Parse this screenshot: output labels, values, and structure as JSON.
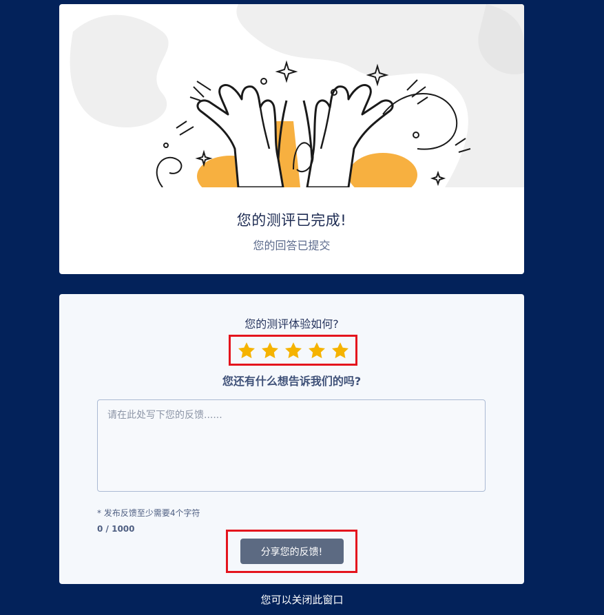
{
  "completion": {
    "title": "您的测评已完成!",
    "subtitle": "您的回答已提交"
  },
  "survey": {
    "rating_question": "您的测评体验如何?",
    "rating": {
      "value": 5,
      "max": 5,
      "star_color": "#f5b301"
    },
    "feedback_question": "您还有什么想告诉我们的吗?",
    "feedback_placeholder": "请在此处写下您的反馈......",
    "feedback_value": "",
    "min_chars_hint": "* 发布反馈至少需要4个字符",
    "char_count": "0 / 1000",
    "submit_label": "分享您的反馈!"
  },
  "footer": {
    "close_note": "您可以关闭此窗口"
  },
  "colors": {
    "page_background": "#03225a",
    "accent_orange": "#f7b040",
    "highlight_red": "#e4141d",
    "button_gray": "#5c6a82"
  }
}
